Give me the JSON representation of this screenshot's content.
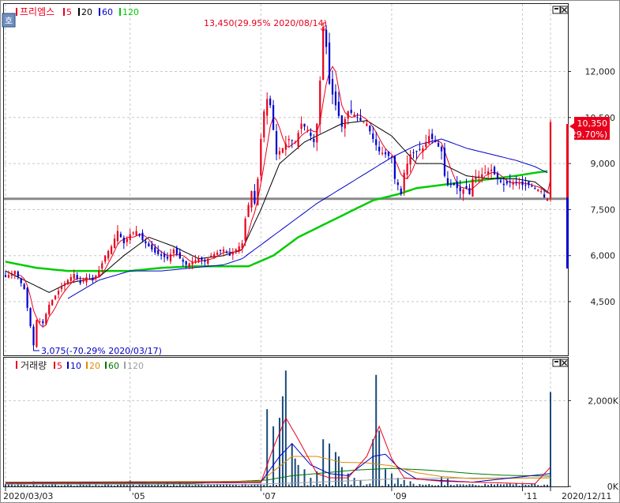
{
  "legend_price": {
    "icon": "ho-icon",
    "name": "프리엠스",
    "items": [
      {
        "label": "5",
        "color": "#e8001c"
      },
      {
        "label": "20",
        "color": "#000000"
      },
      {
        "label": "60",
        "color": "#0000cc"
      },
      {
        "label": "120",
        "color": "#00cc00"
      }
    ]
  },
  "legend_volume": {
    "name": "거래량",
    "items": [
      {
        "label": "5",
        "color": "#e8001c"
      },
      {
        "label": "10",
        "color": "#0000cc"
      },
      {
        "label": "20",
        "color": "#e08a00"
      },
      {
        "label": "60",
        "color": "#007700"
      },
      {
        "label": "120",
        "color": "#a0a0a0"
      }
    ]
  },
  "annotations": {
    "high": "13,450(29.95% 2020/08/14)",
    "low": "3,075(-70.29% 2020/03/17)"
  },
  "current_price": {
    "price": "10,350",
    "change": "( 29.70%)"
  },
  "chart_data": [
    {
      "type": "candlestick",
      "yticks": [
        {
          "value": 12000,
          "label": "12,000"
        },
        {
          "value": 10500,
          "label": "10,500"
        },
        {
          "value": 9000,
          "label": "9,000"
        },
        {
          "value": 7500,
          "label": "7,500"
        },
        {
          "value": 6000,
          "label": "6,000"
        },
        {
          "value": 4500,
          "label": "4,500"
        }
      ],
      "ylim": [
        2750,
        14200
      ],
      "horizontal_line": 7850,
      "keypoints": [
        [
          0,
          5300
        ],
        [
          3,
          5500
        ],
        [
          6,
          4900
        ],
        [
          8,
          3700
        ],
        [
          9,
          3075
        ],
        [
          10,
          3900
        ],
        [
          12,
          3800
        ],
        [
          14,
          4400
        ],
        [
          16,
          4700
        ],
        [
          18,
          5000
        ],
        [
          20,
          5200
        ],
        [
          22,
          5400
        ],
        [
          24,
          5100
        ],
        [
          26,
          5300
        ],
        [
          28,
          5200
        ],
        [
          30,
          5500
        ],
        [
          32,
          6000
        ],
        [
          34,
          6300
        ],
        [
          36,
          6800
        ],
        [
          38,
          6400
        ],
        [
          40,
          6700
        ],
        [
          42,
          6800
        ],
        [
          44,
          6500
        ],
        [
          46,
          6300
        ],
        [
          48,
          6100
        ],
        [
          50,
          6000
        ],
        [
          52,
          5900
        ],
        [
          54,
          6200
        ],
        [
          56,
          5900
        ],
        [
          58,
          5700
        ],
        [
          60,
          5800
        ],
        [
          62,
          5900
        ],
        [
          64,
          5800
        ],
        [
          66,
          6000
        ],
        [
          68,
          6100
        ],
        [
          70,
          6200
        ],
        [
          72,
          6000
        ],
        [
          74,
          6200
        ],
        [
          76,
          6400
        ],
        [
          77,
          7200
        ],
        [
          79,
          8100
        ],
        [
          80,
          7700
        ],
        [
          81,
          8500
        ],
        [
          82,
          9800
        ],
        [
          83,
          10700
        ],
        [
          84,
          11100
        ],
        [
          85,
          10900
        ],
        [
          86,
          10100
        ],
        [
          87,
          9300
        ],
        [
          89,
          9500
        ],
        [
          91,
          9800
        ],
        [
          93,
          9700
        ],
        [
          95,
          10300
        ],
        [
          97,
          10100
        ],
        [
          99,
          9700
        ],
        [
          100,
          10300
        ],
        [
          101,
          11700
        ],
        [
          102,
          13450
        ],
        [
          103,
          12800
        ],
        [
          104,
          11600
        ],
        [
          106,
          10900
        ],
        [
          108,
          10200
        ],
        [
          110,
          10700
        ],
        [
          112,
          10600
        ],
        [
          114,
          10400
        ],
        [
          116,
          10300
        ],
        [
          118,
          9800
        ],
        [
          120,
          9400
        ],
        [
          122,
          9300
        ],
        [
          124,
          9200
        ],
        [
          125,
          8500
        ],
        [
          126,
          8300
        ],
        [
          127,
          8000
        ],
        [
          128,
          8700
        ],
        [
          130,
          9300
        ],
        [
          132,
          9400
        ],
        [
          134,
          9500
        ],
        [
          136,
          9900
        ],
        [
          138,
          9700
        ],
        [
          140,
          9400
        ],
        [
          141,
          8600
        ],
        [
          142,
          8300
        ],
        [
          144,
          8300
        ],
        [
          146,
          8100
        ],
        [
          148,
          8200
        ],
        [
          149,
          8000
        ],
        [
          150,
          8500
        ],
        [
          152,
          8600
        ],
        [
          154,
          8700
        ],
        [
          156,
          8800
        ],
        [
          158,
          8500
        ],
        [
          160,
          8300
        ],
        [
          162,
          8400
        ],
        [
          164,
          8400
        ],
        [
          166,
          8300
        ],
        [
          168,
          8300
        ],
        [
          170,
          8200
        ],
        [
          172,
          8100
        ],
        [
          173,
          7900
        ],
        [
          174,
          7850
        ],
        [
          175,
          10350
        ]
      ],
      "ma_keypoints": {
        "ma20": [
          [
            0,
            5500
          ],
          [
            10,
            5000
          ],
          [
            14,
            4800
          ],
          [
            20,
            5100
          ],
          [
            30,
            5300
          ],
          [
            38,
            6000
          ],
          [
            46,
            6600
          ],
          [
            54,
            6300
          ],
          [
            62,
            5900
          ],
          [
            70,
            6000
          ],
          [
            76,
            6200
          ],
          [
            82,
            7500
          ],
          [
            88,
            9000
          ],
          [
            96,
            9700
          ],
          [
            102,
            10000
          ],
          [
            108,
            10300
          ],
          [
            116,
            10400
          ],
          [
            124,
            9900
          ],
          [
            132,
            9000
          ],
          [
            140,
            9000
          ],
          [
            148,
            8600
          ],
          [
            156,
            8500
          ],
          [
            164,
            8500
          ],
          [
            170,
            8400
          ],
          [
            175,
            8000
          ]
        ],
        "ma60": [
          [
            20,
            4600
          ],
          [
            30,
            5200
          ],
          [
            40,
            5500
          ],
          [
            50,
            5500
          ],
          [
            60,
            5600
          ],
          [
            70,
            5700
          ],
          [
            76,
            5900
          ],
          [
            84,
            6500
          ],
          [
            92,
            7100
          ],
          [
            100,
            7700
          ],
          [
            108,
            8200
          ],
          [
            116,
            8700
          ],
          [
            124,
            9200
          ],
          [
            132,
            9600
          ],
          [
            140,
            9800
          ],
          [
            148,
            9500
          ],
          [
            156,
            9300
          ],
          [
            164,
            9100
          ],
          [
            170,
            8900
          ],
          [
            174,
            8700
          ]
        ],
        "ma120": [
          [
            0,
            5800
          ],
          [
            10,
            5600
          ],
          [
            20,
            5500
          ],
          [
            30,
            5500
          ],
          [
            40,
            5500
          ],
          [
            50,
            5600
          ],
          [
            60,
            5650
          ],
          [
            70,
            5650
          ],
          [
            78,
            5650
          ],
          [
            86,
            6000
          ],
          [
            94,
            6600
          ],
          [
            102,
            7000
          ],
          [
            110,
            7400
          ],
          [
            118,
            7800
          ],
          [
            126,
            8000
          ],
          [
            132,
            8200
          ],
          [
            140,
            8300
          ],
          [
            148,
            8400
          ],
          [
            156,
            8500
          ],
          [
            164,
            8600
          ],
          [
            170,
            8700
          ],
          [
            174,
            8750
          ]
        ]
      }
    },
    {
      "type": "bar",
      "title": "거래량",
      "yticks": [
        {
          "value": 2000,
          "label": "2,000K"
        },
        {
          "value": 0,
          "label": "0K"
        }
      ],
      "ylim": [
        0,
        3000
      ],
      "xticks": [
        {
          "index": 0,
          "label": "2020/03/03"
        },
        {
          "index": 40,
          "label": "'05"
        },
        {
          "index": 82,
          "label": "'07"
        },
        {
          "index": 124,
          "label": "'09"
        },
        {
          "index": 166,
          "label": "'11"
        },
        {
          "index": 175,
          "label": "2020/12/11"
        }
      ],
      "spikes": [
        [
          9,
          120
        ],
        [
          24,
          110
        ],
        [
          40,
          140
        ],
        [
          52,
          90
        ],
        [
          54,
          70
        ],
        [
          56,
          85
        ],
        [
          70,
          50
        ],
        [
          84,
          1800
        ],
        [
          86,
          1400
        ],
        [
          88,
          1600
        ],
        [
          89,
          2100
        ],
        [
          90,
          2700
        ],
        [
          92,
          1000
        ],
        [
          93,
          650
        ],
        [
          94,
          500
        ],
        [
          96,
          400
        ],
        [
          98,
          200
        ],
        [
          100,
          350
        ],
        [
          102,
          1100
        ],
        [
          104,
          1000
        ],
        [
          106,
          800
        ],
        [
          107,
          700
        ],
        [
          108,
          450
        ],
        [
          110,
          300
        ],
        [
          112,
          200
        ],
        [
          114,
          150
        ],
        [
          118,
          1100
        ],
        [
          119,
          2600
        ],
        [
          120,
          1300
        ],
        [
          122,
          400
        ],
        [
          124,
          300
        ],
        [
          126,
          200
        ],
        [
          128,
          150
        ],
        [
          130,
          120
        ],
        [
          140,
          220
        ],
        [
          142,
          180
        ],
        [
          175,
          2200
        ]
      ],
      "ma_keypoints": {
        "ma5": [
          [
            0,
            80
          ],
          [
            82,
            90
          ],
          [
            86,
            900
          ],
          [
            90,
            1600
          ],
          [
            94,
            1100
          ],
          [
            100,
            300
          ],
          [
            104,
            200
          ],
          [
            110,
            200
          ],
          [
            116,
            700
          ],
          [
            120,
            1400
          ],
          [
            124,
            650
          ],
          [
            128,
            200
          ],
          [
            140,
            120
          ],
          [
            170,
            60
          ],
          [
            175,
            450
          ]
        ],
        "ma10": [
          [
            0,
            90
          ],
          [
            82,
            100
          ],
          [
            88,
            700
          ],
          [
            92,
            1000
          ],
          [
            98,
            500
          ],
          [
            104,
            300
          ],
          [
            110,
            250
          ],
          [
            118,
            700
          ],
          [
            122,
            750
          ],
          [
            126,
            450
          ],
          [
            132,
            170
          ],
          [
            150,
            100
          ],
          [
            175,
            300
          ]
        ],
        "ma20": [
          [
            0,
            100
          ],
          [
            82,
            120
          ],
          [
            92,
            700
          ],
          [
            100,
            700
          ],
          [
            108,
            560
          ],
          [
            116,
            550
          ],
          [
            124,
            480
          ],
          [
            132,
            320
          ],
          [
            140,
            230
          ],
          [
            150,
            180
          ],
          [
            175,
            200
          ]
        ],
        "ma60": [
          [
            0,
            70
          ],
          [
            60,
            70
          ],
          [
            84,
            150
          ],
          [
            92,
            250
          ],
          [
            100,
            300
          ],
          [
            112,
            380
          ],
          [
            124,
            420
          ],
          [
            136,
            380
          ],
          [
            150,
            300
          ],
          [
            160,
            260
          ],
          [
            175,
            240
          ]
        ],
        "ma120": [
          [
            0,
            50
          ],
          [
            80,
            50
          ],
          [
            100,
            100
          ],
          [
            130,
            190
          ],
          [
            175,
            200
          ]
        ]
      }
    }
  ]
}
